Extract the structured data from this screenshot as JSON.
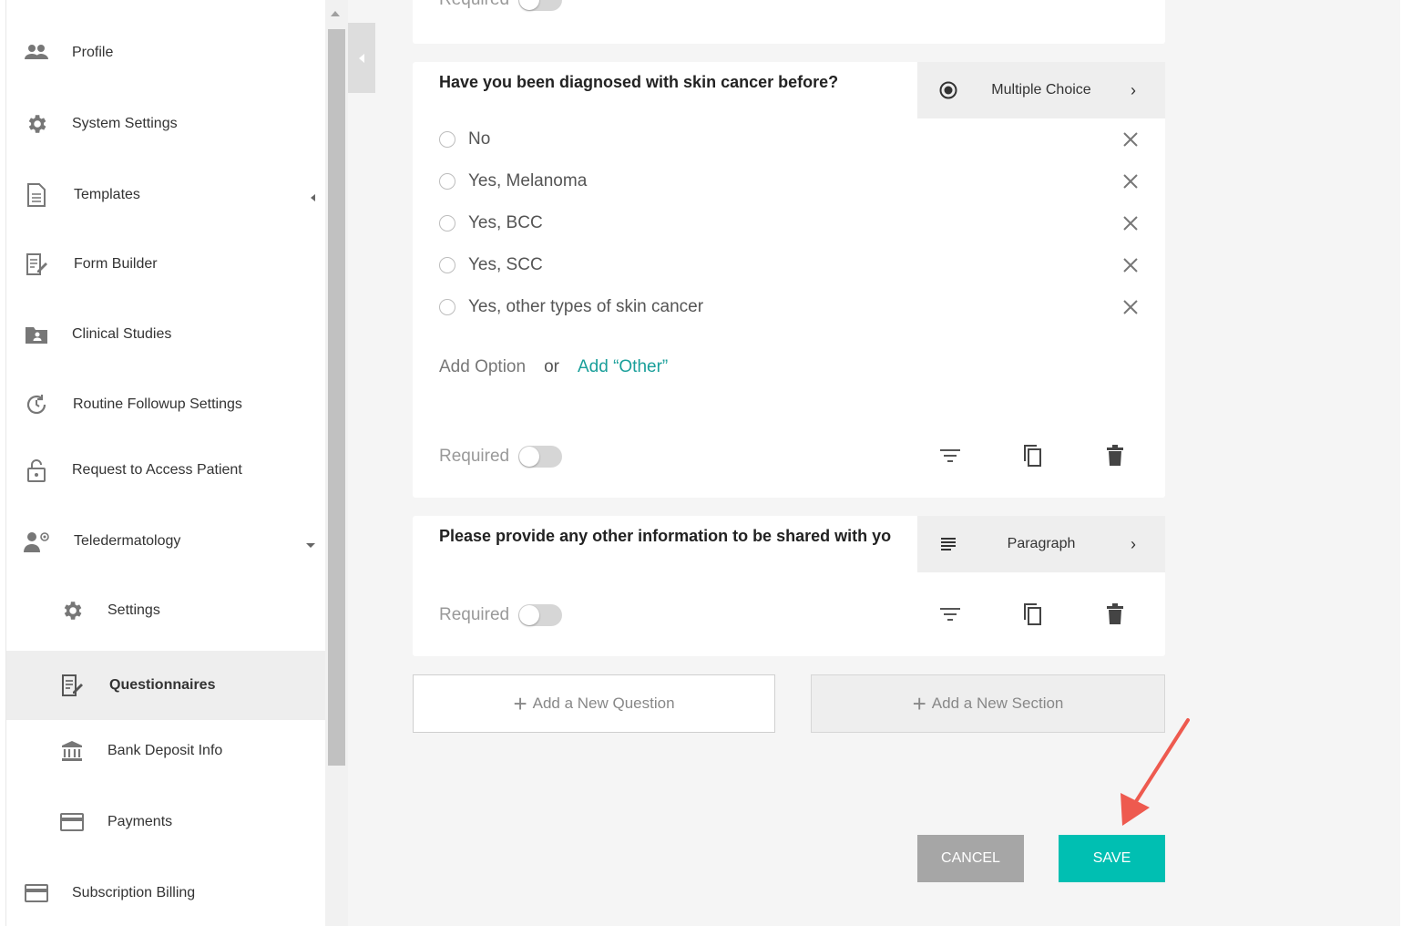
{
  "sidebar": {
    "items": [
      {
        "label": "Profile",
        "icon": "people-icon"
      },
      {
        "label": "System Settings",
        "icon": "gear-icon"
      },
      {
        "label": "Templates",
        "icon": "document-icon"
      },
      {
        "label": "Form Builder",
        "icon": "edit-form-icon"
      },
      {
        "label": "Clinical Studies",
        "icon": "folder-person-icon"
      },
      {
        "label": "Routine Followup Settings",
        "icon": "refresh-clock-icon"
      },
      {
        "label": "Request to Access Patient",
        "icon": "lock-icon"
      },
      {
        "label": "Teledermatology",
        "icon": "doctor-icon"
      },
      {
        "label": "Settings",
        "icon": "gear-icon"
      },
      {
        "label": "Questionnaires",
        "icon": "edit-form-icon"
      },
      {
        "label": "Bank Deposit Info",
        "icon": "bank-icon"
      },
      {
        "label": "Payments",
        "icon": "card-icon"
      },
      {
        "label": "Subscription Billing",
        "icon": "card-icon"
      }
    ]
  },
  "questions": [
    {
      "title": "Have you been diagnosed with skin cancer before?",
      "type_label": "Multiple Choice",
      "options": [
        "No",
        "Yes, Melanoma",
        "Yes, BCC",
        "Yes, SCC",
        "Yes, other types of skin cancer"
      ],
      "add_option": "Add Option",
      "or": "or",
      "add_other": "Add “Other”",
      "required_label": "Required"
    },
    {
      "title": "Please provide any other information to be shared with your",
      "type_label": "Paragraph",
      "required_label": "Required"
    }
  ],
  "buttons": {
    "add_question": "Add a New Question",
    "add_section": "Add a New Section",
    "cancel": "CANCEL",
    "save": "SAVE"
  },
  "colors": {
    "accent": "#1aa59f",
    "save": "#00bfb2",
    "cancel": "#a6a6a6",
    "arrow": "#ee5a4f"
  }
}
